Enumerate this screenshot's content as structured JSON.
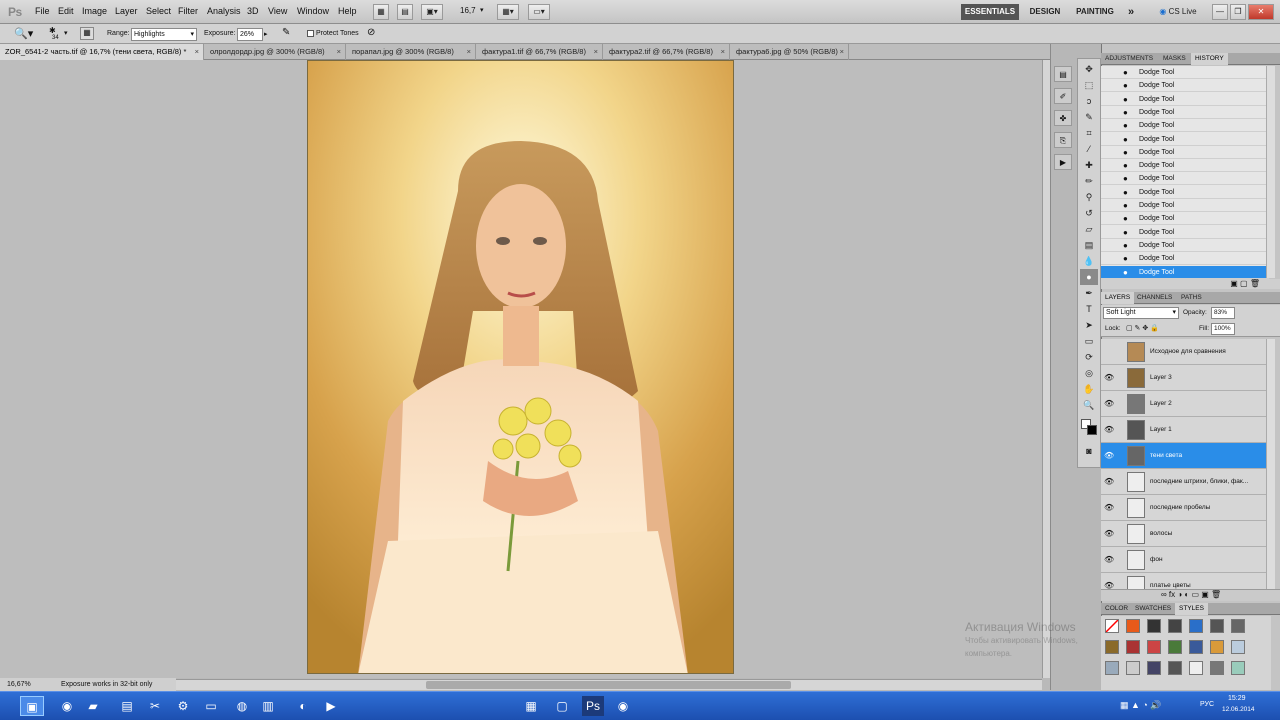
{
  "app": {
    "logo": "Ps"
  },
  "menu": [
    "File",
    "Edit",
    "Image",
    "Layer",
    "Select",
    "Filter",
    "Analysis",
    "3D",
    "View",
    "Window",
    "Help"
  ],
  "toolbar_zoom": "16,7",
  "workspaces": {
    "essentials": "ESSENTIALS",
    "design": "DESIGN",
    "painting": "PAINTING",
    "more": "»",
    "cslive": "CS Live"
  },
  "options": {
    "brush_size": "34",
    "range_label": "Range:",
    "range_value": "Highlights",
    "exposure_label": "Exposure:",
    "exposure_value": "26%",
    "protect_tones": "Protect Tones"
  },
  "tabs": [
    {
      "label": "ZOR_6541-2 часть.tif @ 16,7% (тени света, RGB/8) *",
      "active": true
    },
    {
      "label": "олролдордр.jpg @ 300% (RGB/8)",
      "active": false
    },
    {
      "label": "порапал.jpg @ 300% (RGB/8)",
      "active": false
    },
    {
      "label": "фактура1.tif @ 66,7% (RGB/8)",
      "active": false
    },
    {
      "label": "фактура2.tif @ 66,7% (RGB/8)",
      "active": false
    },
    {
      "label": "фактура6.jpg @ 50% (RGB/8)",
      "active": false
    }
  ],
  "status": {
    "zoom": "16,67%",
    "message": "Exposure works in 32-bit only"
  },
  "panel_tabs_top": [
    "ADJUSTMENTS",
    "MASKS",
    "HISTORY"
  ],
  "history": [
    "Dodge Tool",
    "Dodge Tool",
    "Dodge Tool",
    "Dodge Tool",
    "Dodge Tool",
    "Dodge Tool",
    "Dodge Tool",
    "Dodge Tool",
    "Dodge Tool",
    "Dodge Tool",
    "Dodge Tool",
    "Dodge Tool",
    "Dodge Tool",
    "Dodge Tool",
    "Dodge Tool",
    "Dodge Tool"
  ],
  "panel_tabs_layers": [
    "LAYERS",
    "CHANNELS",
    "PATHS"
  ],
  "layers_opts": {
    "blend": "Soft Light",
    "opacity_label": "Opacity:",
    "opacity": "83%",
    "lock_label": "Lock:",
    "fill_label": "Fill:",
    "fill": "100%"
  },
  "layers": [
    {
      "name": "Исходное для сравнения",
      "visible": false,
      "selected": false
    },
    {
      "name": "Layer 3",
      "visible": true,
      "selected": false
    },
    {
      "name": "Layer 2",
      "visible": true,
      "selected": false
    },
    {
      "name": "Layer 1",
      "visible": true,
      "selected": false
    },
    {
      "name": "тени света",
      "visible": true,
      "selected": true
    },
    {
      "name": "последние штрихи, блики, фак...",
      "visible": true,
      "selected": false
    },
    {
      "name": "последние пробелы",
      "visible": true,
      "selected": false
    },
    {
      "name": "волосы",
      "visible": true,
      "selected": false
    },
    {
      "name": "фон",
      "visible": true,
      "selected": false
    },
    {
      "name": "платье цветы",
      "visible": true,
      "selected": false
    }
  ],
  "panel_tabs_styles": [
    "COLOR",
    "SWATCHES",
    "STYLES"
  ],
  "watermark": {
    "title": "Активация Windows",
    "line1": "Чтобы активировать Windows,",
    "line2": "компьютера."
  },
  "taskbar": {
    "time": "15:29",
    "date": "12.06.2014",
    "lang": "РУС"
  }
}
